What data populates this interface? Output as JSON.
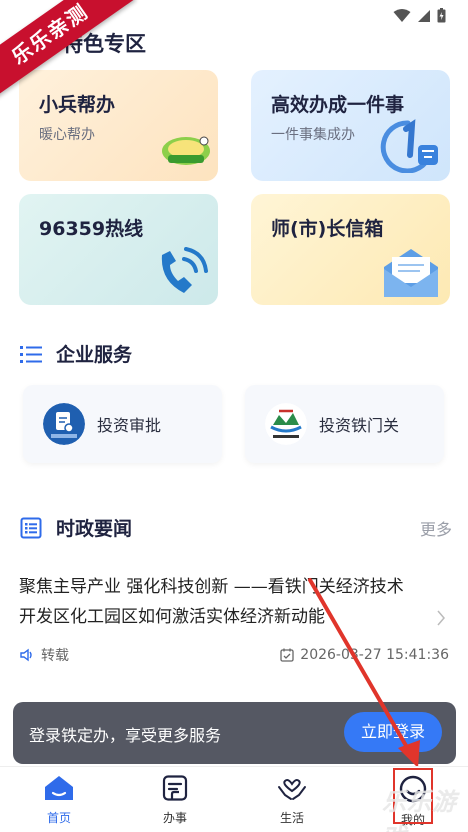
{
  "ribbon": {
    "text": "乐乐亲测"
  },
  "special": {
    "title": "特色专区"
  },
  "cards": {
    "xiaobing": {
      "title": "小兵帮办",
      "sub": "暖心帮办"
    },
    "gaoxiao": {
      "title": "高效办成一件事",
      "sub": "一件事集成办"
    },
    "hotline": {
      "title": "96359热线"
    },
    "mailbox": {
      "title": "师(市)长信箱"
    }
  },
  "enterprise": {
    "title": "企业服务",
    "items": [
      {
        "label": "投资审批"
      },
      {
        "label": "投资铁门关"
      }
    ]
  },
  "news": {
    "title": "时政要闻",
    "more": "更多",
    "items": [
      {
        "title": "聚焦主导产业 强化科技创新 ——看铁门关经济技术开发区化工园区如何激活实体经济新动能",
        "tag": "转载",
        "time": "2026-03-27 15:41:36"
      }
    ]
  },
  "login_bar": {
    "text": "登录铁定办，享受更多服务",
    "button": "立即登录"
  },
  "tabs": [
    {
      "label": "首页",
      "active": true
    },
    {
      "label": "办事",
      "active": false
    },
    {
      "label": "生活",
      "active": false
    },
    {
      "label": "我的",
      "active": false
    }
  ],
  "watermark": {
    "text": "乐乐游戏"
  },
  "colors": {
    "accent": "#2f6bea",
    "title": "#1f2340",
    "login_button": "#3579f6"
  }
}
